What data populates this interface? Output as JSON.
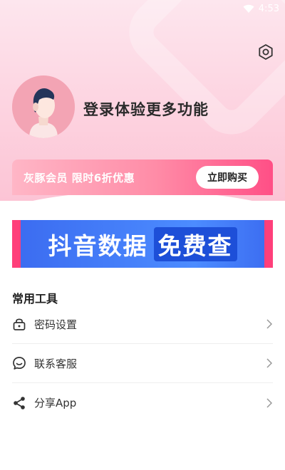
{
  "status_bar": {
    "time": "4:53"
  },
  "profile": {
    "login_prompt": "登录体验更多功能"
  },
  "vip": {
    "text": "灰豚会员 限时6折优惠",
    "button": "立即购买"
  },
  "banner": {
    "text_main": "抖音数据",
    "text_highlight": "免费查"
  },
  "tools": {
    "title": "常用工具",
    "items": [
      {
        "label": "密码设置",
        "icon": "lock-icon"
      },
      {
        "label": "联系客服",
        "icon": "chat-icon"
      },
      {
        "label": "分享App",
        "icon": "share-icon"
      }
    ]
  },
  "colors": {
    "header_pink": "#fdd3e0",
    "vip_gradient_end": "#ff4f86",
    "banner_blue": "#4c8cff",
    "banner_edge": "#ff3f7a"
  }
}
